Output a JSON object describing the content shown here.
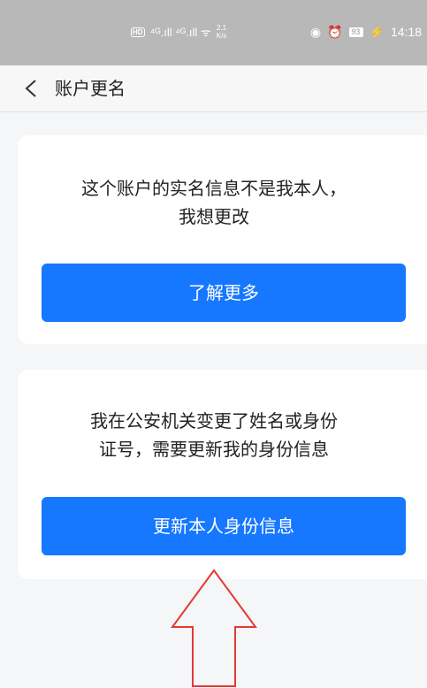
{
  "status_bar": {
    "hd": "HD",
    "left_glyphs": "⁴ᴳ.ıll ⁴ᴳ.ıll ᯤ",
    "net_speed_value": "2.1",
    "net_speed_unit": "K/s",
    "eye_icon": "◉",
    "alarm_icon": "⏰",
    "battery_level": "93",
    "charging_icon": "⚡",
    "time": "14:18"
  },
  "nav": {
    "title": "账户更名",
    "back_icon": "chevron-left-icon"
  },
  "cards": [
    {
      "description_line1": "这个账户的实名信息不是我本人，",
      "description_line2": "我想更改",
      "button_label": "了解更多"
    },
    {
      "description_line1": "我在公安机关变更了姓名或身份",
      "description_line2": "证号，需要更新我的身份信息",
      "button_label": "更新本人身份信息"
    }
  ],
  "annotation": {
    "icon": "arrow-up-outline-icon",
    "color": "#e53935"
  },
  "colors": {
    "primary_button": "#1677ff",
    "page_background": "#f5f6f7",
    "status_bar": "#b8b8b8"
  }
}
